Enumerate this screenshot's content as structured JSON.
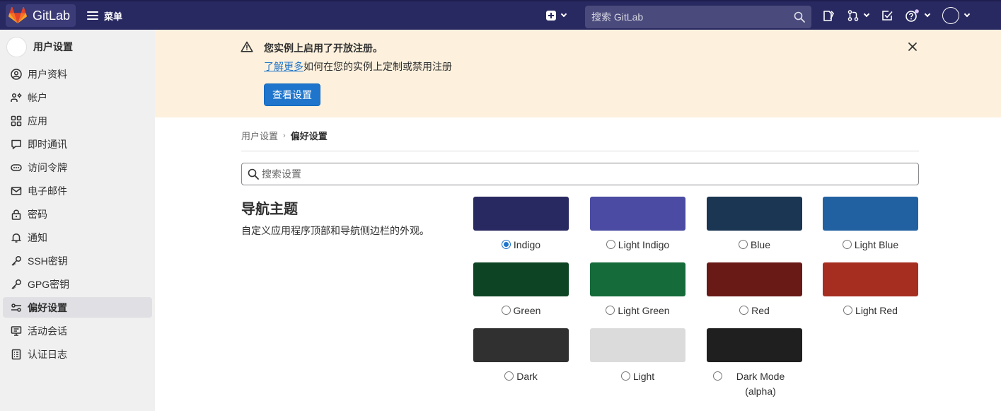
{
  "topbar": {
    "brand": "GitLab",
    "menu_label": "菜单",
    "search_placeholder": "搜索 GitLab"
  },
  "sidebar": {
    "title": "用户设置",
    "items": [
      {
        "label": "用户资料",
        "icon": "profile-icon"
      },
      {
        "label": "帐户",
        "icon": "account-icon"
      },
      {
        "label": "应用",
        "icon": "applications-icon"
      },
      {
        "label": "即时通讯",
        "icon": "chat-icon"
      },
      {
        "label": "访问令牌",
        "icon": "token-icon"
      },
      {
        "label": "电子邮件",
        "icon": "mail-icon"
      },
      {
        "label": "密码",
        "icon": "lock-icon"
      },
      {
        "label": "通知",
        "icon": "bell-icon"
      },
      {
        "label": "SSH密钥",
        "icon": "key-icon"
      },
      {
        "label": "GPG密钥",
        "icon": "key-icon"
      },
      {
        "label": "偏好设置",
        "icon": "preferences-icon",
        "active": true
      },
      {
        "label": "活动会话",
        "icon": "monitor-icon"
      },
      {
        "label": "认证日志",
        "icon": "log-icon"
      }
    ]
  },
  "banner": {
    "title": "您实例上启用了开放注册。",
    "link_text": "了解更多",
    "body_text": "如何在您的实例上定制或禁用注册",
    "button_label": "查看设置"
  },
  "breadcrumb": {
    "parent": "用户设置",
    "separator": "›",
    "current": "偏好设置"
  },
  "settings_search": {
    "placeholder": "搜索设置"
  },
  "section": {
    "title": "导航主题",
    "description": "自定义应用程序顶部和导航侧边栏的外观。"
  },
  "themes": [
    {
      "name": "Indigo",
      "color": "#292961",
      "selected": true
    },
    {
      "name": "Light Indigo",
      "color": "#4b4ba3",
      "selected": false
    },
    {
      "name": "Blue",
      "color": "#1a3652",
      "selected": false
    },
    {
      "name": "Light Blue",
      "color": "#2261a1",
      "selected": false
    },
    {
      "name": "Green",
      "color": "#0d4524",
      "selected": false
    },
    {
      "name": "Light Green",
      "color": "#156b39",
      "selected": false
    },
    {
      "name": "Red",
      "color": "#691a16",
      "selected": false
    },
    {
      "name": "Light Red",
      "color": "#a62e21",
      "selected": false
    },
    {
      "name": "Dark",
      "color": "#303030",
      "selected": false
    },
    {
      "name": "Light",
      "color": "#dbdbdb",
      "selected": false
    },
    {
      "name": "Dark Mode (alpha)",
      "color": "#1f1f1f",
      "selected": false
    }
  ]
}
